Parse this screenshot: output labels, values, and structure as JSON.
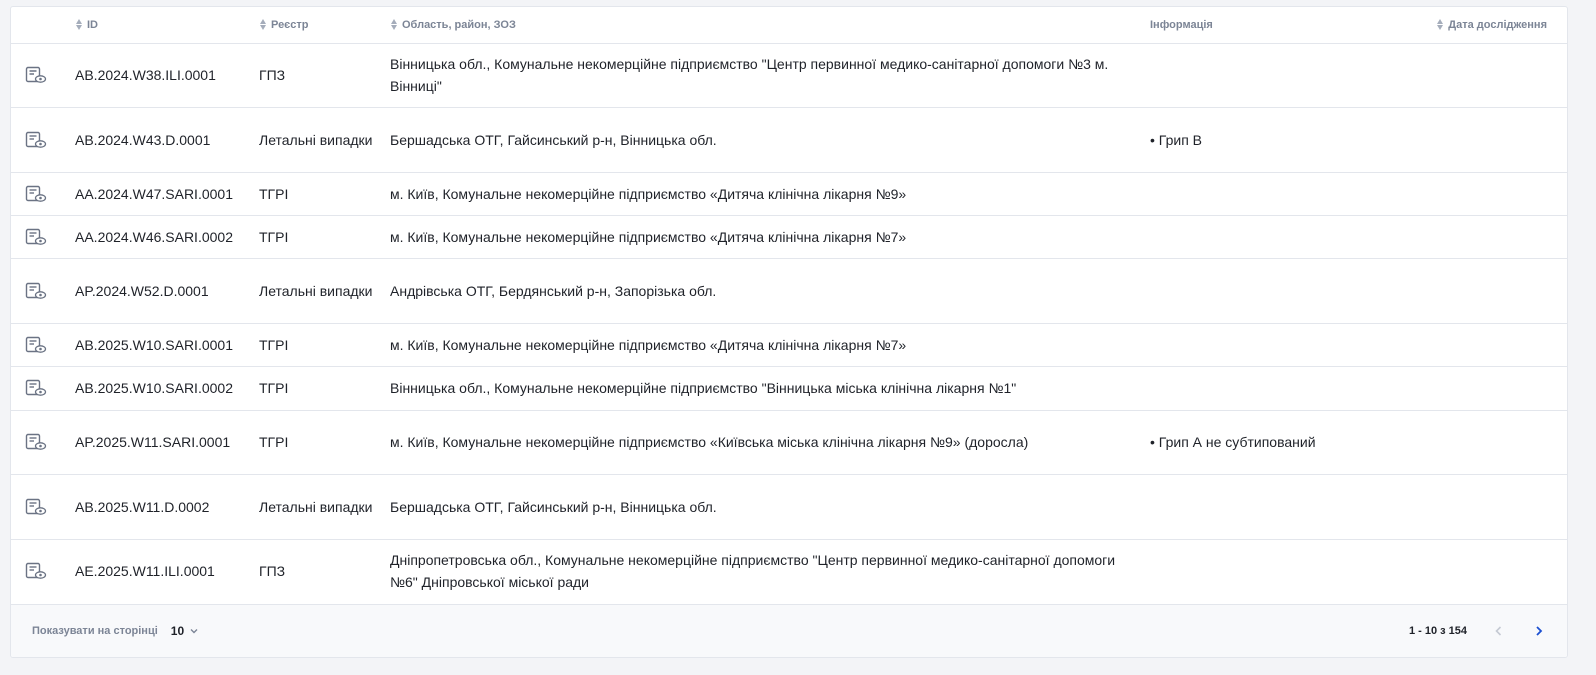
{
  "table": {
    "headers": {
      "id": "ID",
      "registry": "Реєстр",
      "region": "Область, район, ЗОЗ",
      "info": "Інформація",
      "date": "Дата дослідження"
    },
    "rows": [
      {
        "id": "AB.2024.W38.ILI.0001",
        "registry": "ГПЗ",
        "region": "Вінницька обл., Комунальне некомерційне підприємство \"Центр первинної медико-санітарної допомоги №3 м. Вінниці\"",
        "info": [],
        "date": ""
      },
      {
        "id": "AB.2024.W43.D.0001",
        "registry": "Летальні випадки",
        "region": "Бершадська ОТГ, Гайсинський р-н, Вінницька обл.",
        "info": [
          "Грип B"
        ],
        "date": ""
      },
      {
        "id": "AA.2024.W47.SARI.0001",
        "registry": "ТГРІ",
        "region": "м. Київ, Комунальне некомерційне підприємство «Дитяча клінічна лікарня №9»",
        "info": [],
        "date": ""
      },
      {
        "id": "AA.2024.W46.SARI.0002",
        "registry": "ТГРІ",
        "region": "м. Київ, Комунальне некомерційне підприємство «Дитяча клінічна лікарня №7»",
        "info": [],
        "date": ""
      },
      {
        "id": "AP.2024.W52.D.0001",
        "registry": "Летальні випадки",
        "region": "Андрівська ОТГ, Бердянський р-н, Запорізька обл.",
        "info": [],
        "date": ""
      },
      {
        "id": "AB.2025.W10.SARI.0001",
        "registry": "ТГРІ",
        "region": "м. Київ, Комунальне некомерційне підприємство «Дитяча клінічна лікарня №7»",
        "info": [],
        "date": ""
      },
      {
        "id": "AB.2025.W10.SARI.0002",
        "registry": "ТГРІ",
        "region": "Вінницька обл., Комунальне некомерційне підприємство \"Вінницька міська клінічна лікарня №1\"",
        "info": [],
        "date": ""
      },
      {
        "id": "AP.2025.W11.SARI.0001",
        "registry": "ТГРІ",
        "region": "м. Київ, Комунальне некомерційне підприємство «Київська міська клінічна лікарня №9» (доросла)",
        "info": [
          "Грип А не субтипований"
        ],
        "date": ""
      },
      {
        "id": "AB.2025.W11.D.0002",
        "registry": "Летальні випадки",
        "region": "Бершадська ОТГ, Гайсинський р-н, Вінницька обл.",
        "info": [],
        "date": ""
      },
      {
        "id": "AE.2025.W11.ILI.0001",
        "registry": "ГПЗ",
        "region": "Дніпропетровська обл., Комунальне некомерційне підприємство \"Центр первинної медико-санітарної допомоги №6\" Дніпровської міської ради",
        "info": [],
        "date": ""
      }
    ],
    "row_icon": "view-document-icon"
  },
  "pagination": {
    "rows_per_page_label": "Показувати на сторінці",
    "rows_per_page_value": "10",
    "range_text": "1 - 10 з 154",
    "prev_icon": "chevron-left-icon",
    "next_icon": "chevron-right-icon"
  },
  "colors": {
    "header_text": "#7c8596",
    "border": "#e3e6ec",
    "accent": "#1b4fd1",
    "disabled": "#c5cad3"
  }
}
